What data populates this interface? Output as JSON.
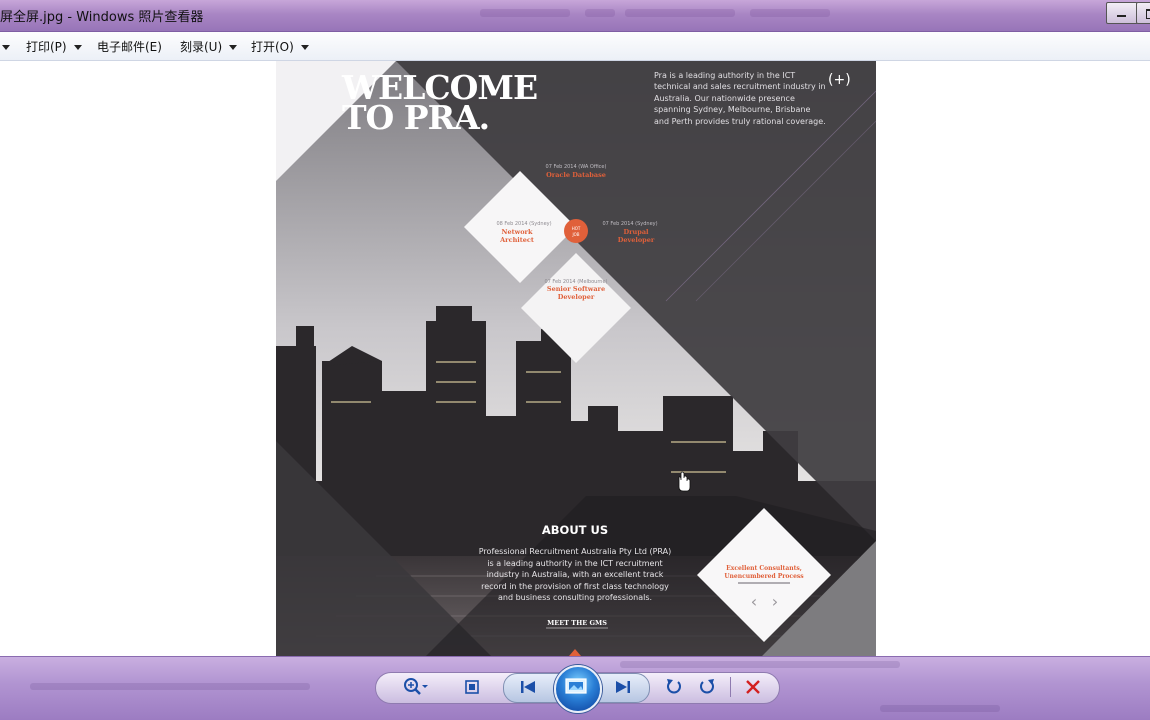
{
  "window": {
    "title": "屏全屏.jpg - Windows 照片查看器"
  },
  "menu": {
    "items": [
      {
        "label": "打印(P)"
      },
      {
        "label": "电子邮件(E)"
      },
      {
        "label": "刻录(U)"
      },
      {
        "label": "打开(O)"
      }
    ]
  },
  "image": {
    "welcome_line1": "WELCOME",
    "welcome_line2": "TO PRA.",
    "intro_text": [
      "Pra is a leading authority in the ICT",
      "technical and sales recruitment industry in",
      "Australia. Our nationwide presence",
      "spanning Sydney, Melbourne, Brisbane",
      "and Perth provides truly rational coverage."
    ],
    "plus_label": "(+)",
    "jobs": [
      {
        "date": "07 Feb 2014 (WA Office)",
        "title": [
          "Oracle Database"
        ]
      },
      {
        "date": "08 Feb 2014 (Sydney)",
        "title": [
          "Network",
          "Architect"
        ]
      },
      {
        "date": "07 Feb 2014 (Sydney)",
        "title": [
          "Drupal",
          "Developer"
        ]
      },
      {
        "date": "07 Feb 2014 (Melbourne)",
        "title": [
          "Senior Software",
          "Developer"
        ]
      }
    ],
    "hot_badge": [
      "HOT",
      "JOB"
    ],
    "about_title": "ABOUT US",
    "about_text": [
      "Professional Recruitment Australia Pty Ltd (PRA)",
      "is a leading authority in the ICT recruitment",
      "industry in Australia, with an excellent track",
      "record in the provision of first class technology",
      "and business consulting professionals."
    ],
    "meet_link": "MEET THE GMS",
    "testimonial": [
      "Excellent Consultants,",
      "Unencumbered Process"
    ],
    "prev_arrow": "‹",
    "next_arrow": "›"
  },
  "colors": {
    "accent_orange": "#e0603a",
    "panel_dark": "#4a484c",
    "titlebar": "#a986c4",
    "bottombar": "#b295d2"
  },
  "icons": [
    "zoom-icon",
    "fit-window-icon",
    "previous-icon",
    "slideshow-icon",
    "next-icon",
    "rotate-left-icon",
    "rotate-right-icon",
    "delete-icon"
  ]
}
